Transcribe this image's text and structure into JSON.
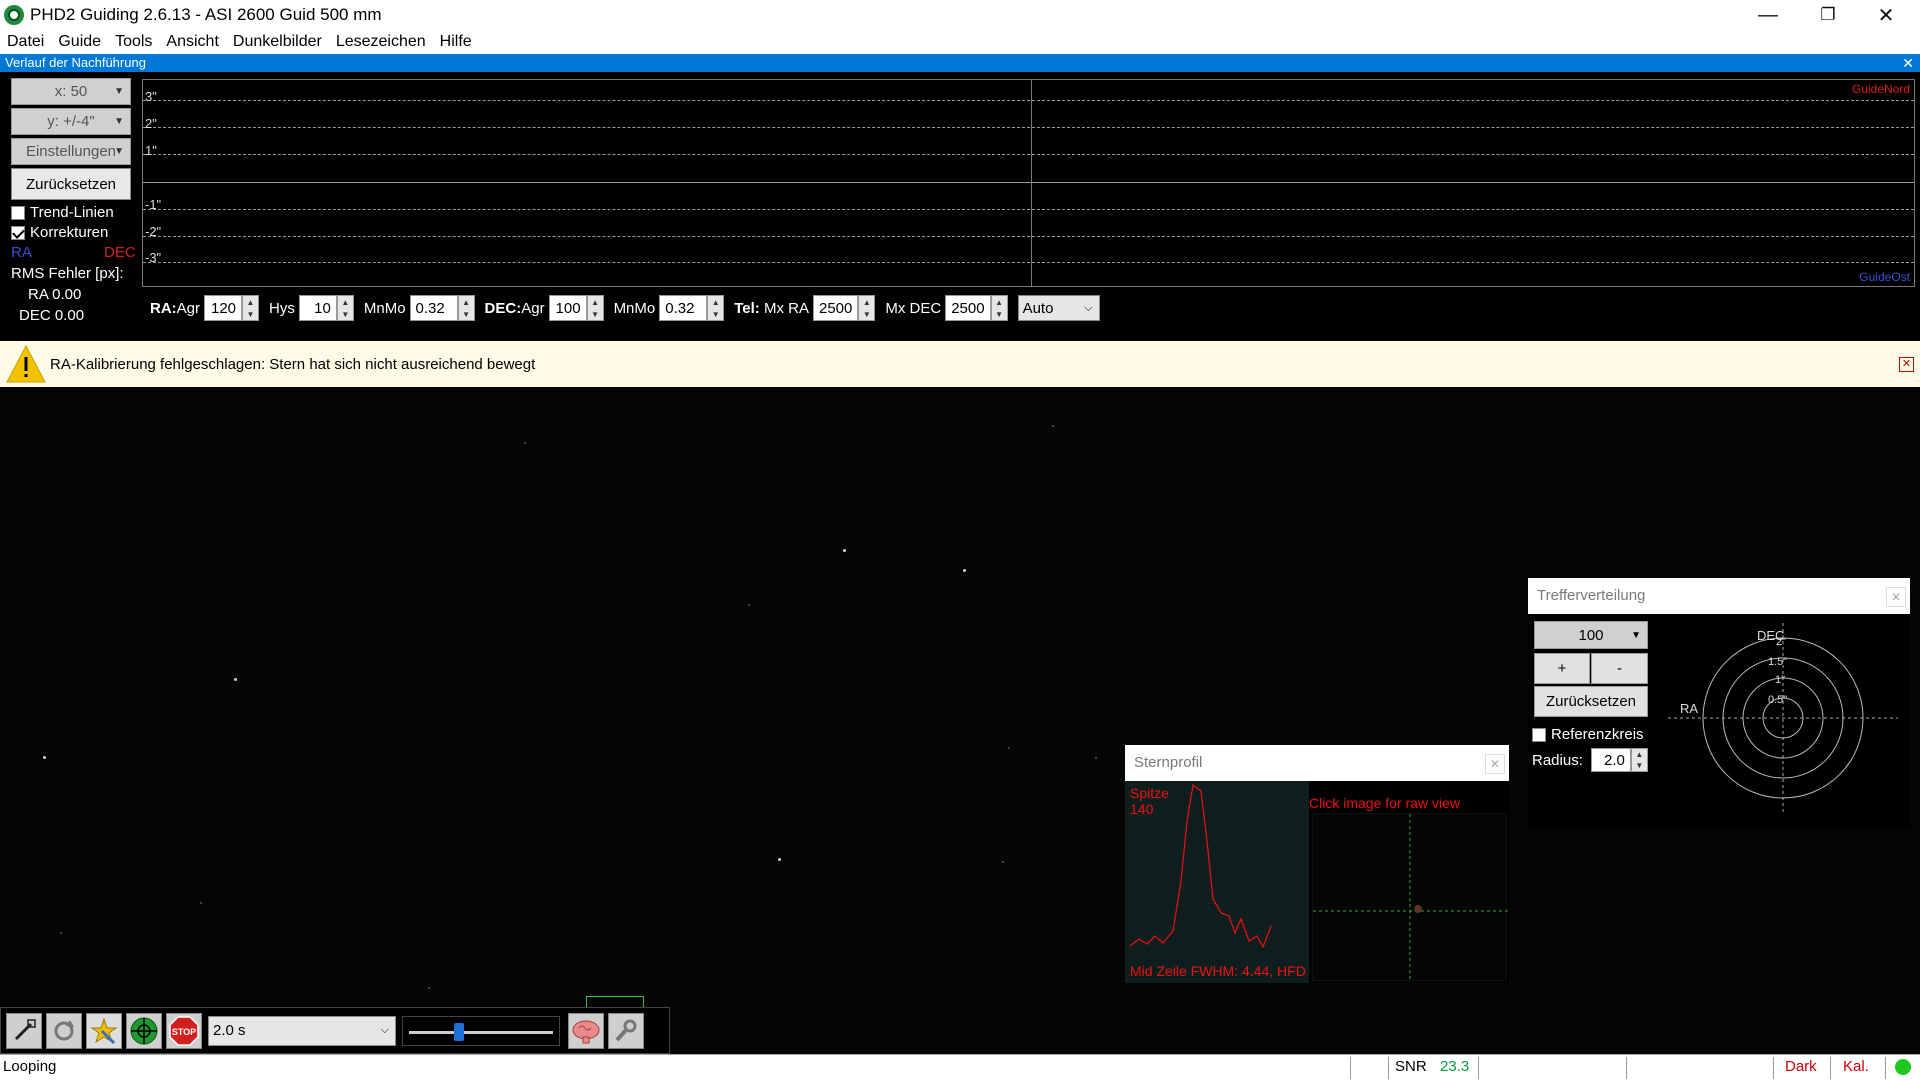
{
  "window": {
    "title": "PHD2 Guiding 2.6.13 - ASI 2600 Guid 500 mm",
    "minimize": "—",
    "maximize": "❐",
    "close": "✕"
  },
  "menu": [
    "Datei",
    "Guide",
    "Tools",
    "Ansicht",
    "Dunkelbilder",
    "Lesezeichen",
    "Hilfe"
  ],
  "graph_panel": {
    "title": "Verlauf der Nachführung",
    "x_scale": "x: 50",
    "y_scale": "y: +/-4\"",
    "settings": "Einstellungen",
    "reset": "Zurücksetzen",
    "trend_lines": "Trend-Linien",
    "corrections": "Korrekturen",
    "trend_checked": false,
    "corrections_checked": true,
    "ra_label": "RA",
    "dec_label": "DEC",
    "ra_color": "#3a4fd0",
    "dec_color": "#d81e1e",
    "rms_title": "RMS Fehler [px]:",
    "rms_ra": "RA 0.00",
    "rms_dec": "DEC 0.00",
    "y_labels": [
      "3\"",
      "2\"",
      "1\"",
      "-1\"",
      "-2\"",
      "-3\""
    ],
    "north_label": "GuideNord",
    "east_label": "GuideOst"
  },
  "params": {
    "ra_label": "RA:",
    "agr_label": "Agr",
    "ra_agr": "120",
    "hys_label": "Hys",
    "hys": "10",
    "mnmo_label": "MnMo",
    "ra_mnmo": "0.32",
    "dec_label": "DEC:",
    "dec_agr": "100",
    "dec_mnmo": "0.32",
    "tel_label": "Tel:",
    "mxra_label": "Mx RA",
    "mx_ra": "2500",
    "mxdec_label": "Mx DEC",
    "mx_dec": "2500",
    "mode": "Auto"
  },
  "alert": {
    "text": "RA-Kalibrierung fehlgeschlagen: Stern hat sich nicht ausreichend bewegt",
    "close": "✕"
  },
  "target_panel": {
    "title": "Trefferverteilung",
    "count": "100",
    "plus": "+",
    "minus": "-",
    "reset": "Zurücksetzen",
    "ref_circle": "Referenzkreis",
    "radius_label": "Radius:",
    "radius": "2.0",
    "dec_axis": "DEC",
    "ra_axis": "RA",
    "ring_labels": [
      "2\"",
      "1.5\"",
      "1\"",
      "0.5\""
    ]
  },
  "star_profile": {
    "title": "Sternprofil",
    "peak_label": "Spitze",
    "peak_value": "140",
    "click_hint": "Click image for raw view",
    "fwhm": "Mid Zeile FWHM: 4.44, HFD",
    "line_color": "#e11111"
  },
  "toolbar": {
    "exposure": "2.0 s",
    "gamma_level": 0.33,
    "icons": [
      "usb-connect-icon",
      "loop-icon",
      "auto-select-star-icon",
      "guide-icon",
      "stop-icon",
      "brain-icon",
      "wrench-icon"
    ]
  },
  "status": {
    "message": "Looping",
    "snr_label": "SNR",
    "snr_value": "23.3",
    "dark": "Dark",
    "kal": "Kal.",
    "led_color": "#1ec81e"
  }
}
